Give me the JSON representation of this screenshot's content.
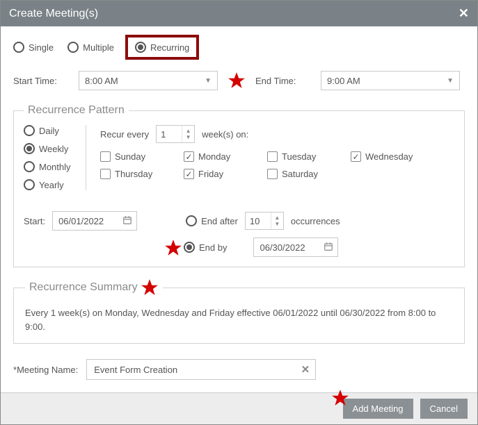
{
  "title": "Create Meeting(s)",
  "type": {
    "single": "Single",
    "multiple": "Multiple",
    "recurring": "Recurring"
  },
  "time": {
    "start_label": "Start Time:",
    "start_value": "8:00 AM",
    "end_label": "End Time:",
    "end_value": "9:00 AM"
  },
  "pattern": {
    "legend": "Recurrence Pattern",
    "freq": {
      "daily": "Daily",
      "weekly": "Weekly",
      "monthly": "Monthly",
      "yearly": "Yearly"
    },
    "recur_prefix": "Recur every",
    "recur_value": "1",
    "recur_suffix": "week(s) on:",
    "days": {
      "sun": "Sunday",
      "mon": "Monday",
      "tue": "Tuesday",
      "wed": "Wednesday",
      "thu": "Thursday",
      "fri": "Friday",
      "sat": "Saturday"
    },
    "start_label": "Start:",
    "start_date": "06/01/2022",
    "end_after_label": "End after",
    "end_after_value": "10",
    "occurrences_label": "occurrences",
    "end_by_label": "End by",
    "end_by_date": "06/30/2022"
  },
  "summary": {
    "legend": "Recurrence Summary",
    "text": "Every 1 week(s) on Monday, Wednesday and Friday effective 06/01/2022 until 06/30/2022 from 8:00 to 9:00."
  },
  "name": {
    "label": "Meeting Name:",
    "value": "Event Form Creation"
  },
  "buttons": {
    "add": "Add Meeting",
    "cancel": "Cancel"
  }
}
